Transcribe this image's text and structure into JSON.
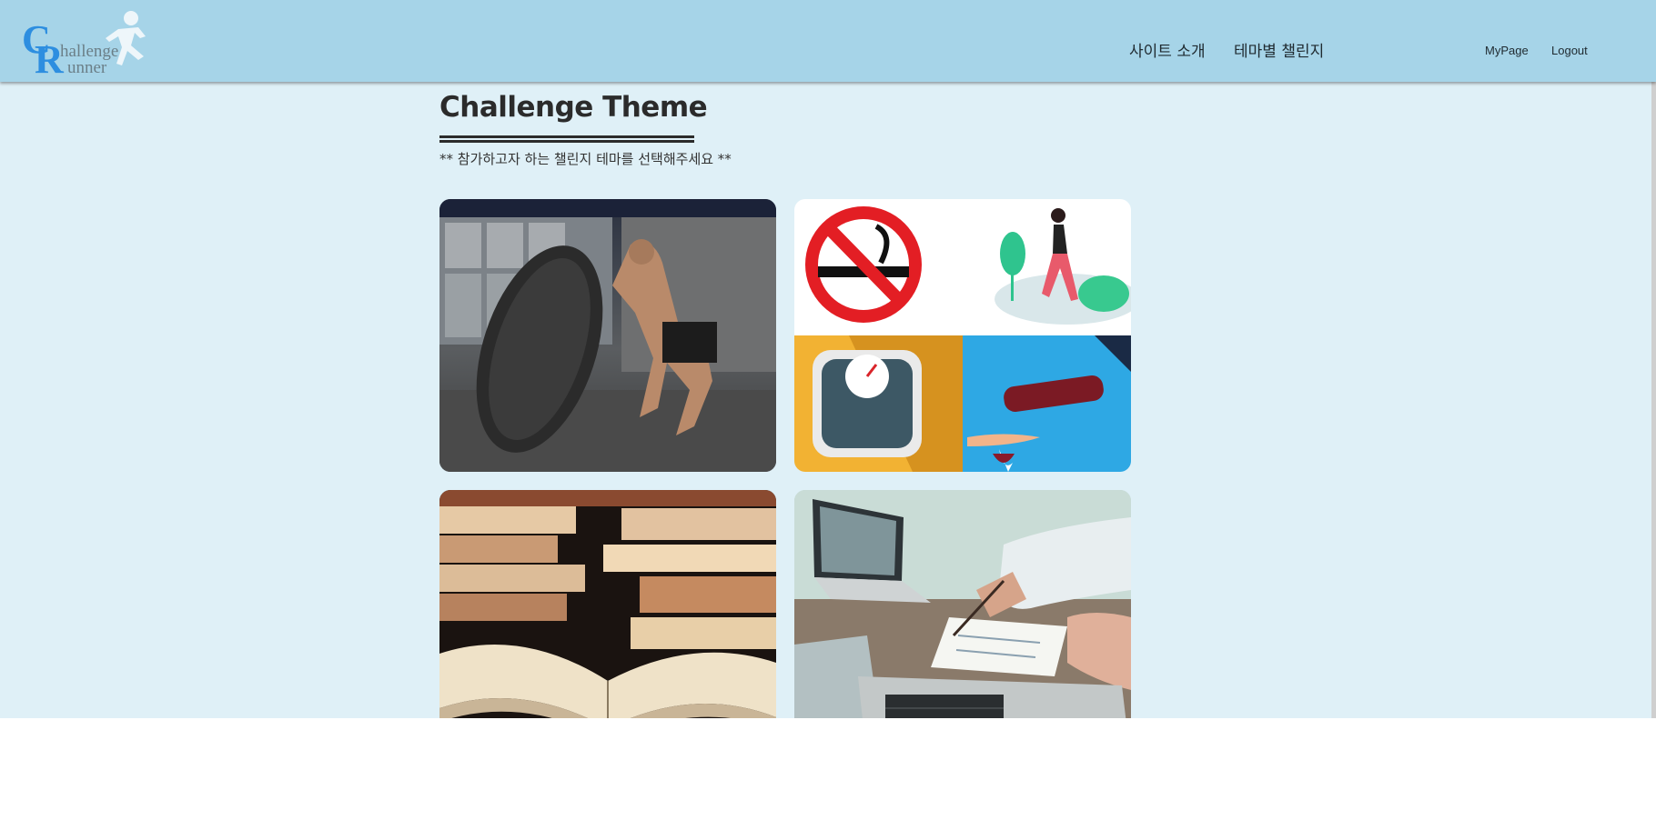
{
  "header": {
    "logo_letter_c": "C",
    "logo_letter_r": "R",
    "logo_word_1": "hallenge",
    "logo_word_2": "unner",
    "nav": {
      "about": "사이트 소개",
      "themes": "테마별 챌린지"
    },
    "user": {
      "mypage": "MyPage",
      "logout": "Logout"
    }
  },
  "main": {
    "title": "Challenge Theme",
    "subtitle": "** 참가하고자 하는 챌린지 테마를 선택해주세요 **",
    "themes": [
      {
        "image": "tire-workout-photo"
      },
      {
        "image": "habit-icons-collage"
      },
      {
        "image": "books-reading-photo"
      },
      {
        "image": "laptop-study-photo"
      }
    ]
  },
  "colors": {
    "header_bg": "#a6d4e8",
    "page_bg": "#dff0f7",
    "logo_blue": "#2d8ee0",
    "text_dark": "#2b2b2b"
  }
}
